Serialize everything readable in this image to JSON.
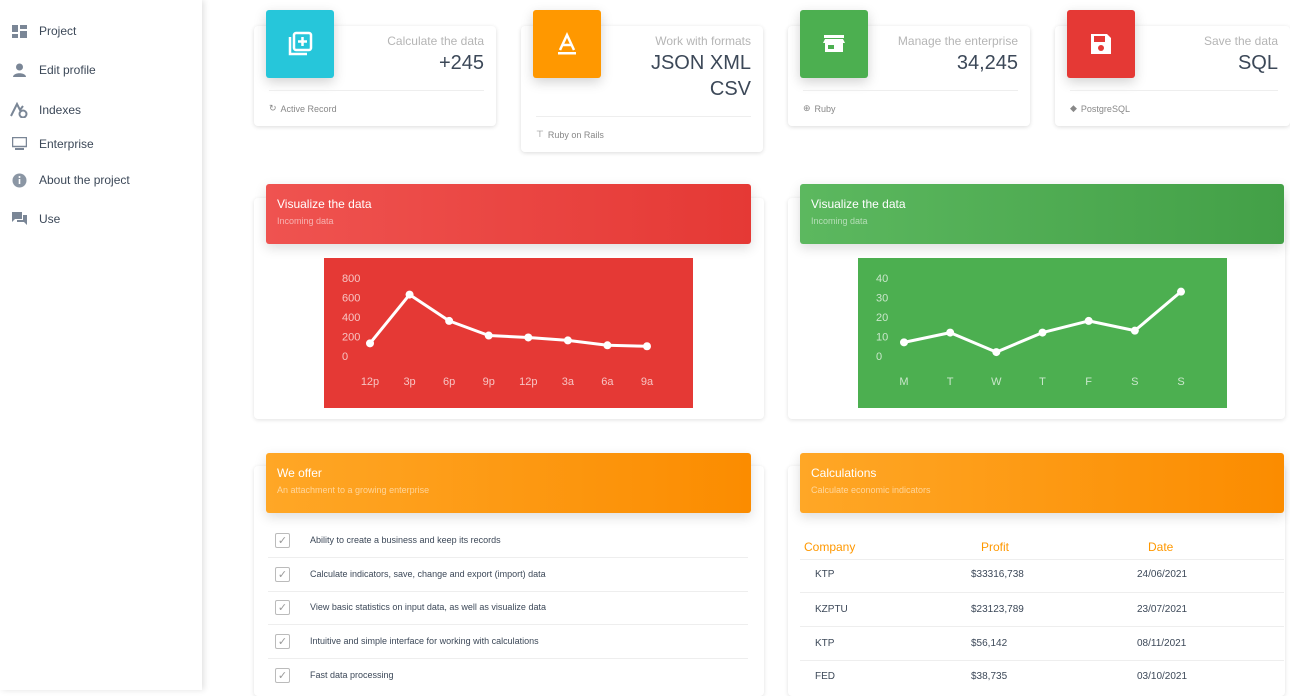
{
  "sidebar": {
    "items": [
      {
        "label": "Project",
        "icon": "dashboard-icon"
      },
      {
        "label": "Edit profile",
        "icon": "person-icon"
      },
      {
        "label": "Indexes",
        "icon": "chart-settings-icon"
      },
      {
        "label": "Enterprise",
        "icon": "monitor-icon"
      },
      {
        "label": "About the project",
        "icon": "info-icon"
      },
      {
        "label": "Use",
        "icon": "forum-icon"
      }
    ]
  },
  "stats": [
    {
      "category": "Calculate the data",
      "value": "+245",
      "footer": "Active Record",
      "color": "#26c6da",
      "icon": "filter-plus-icon",
      "footer_icon": "refresh-icon"
    },
    {
      "category": "Work with formats",
      "value": "JSON XML CSV",
      "footer": "Ruby on Rails",
      "color": "#ff9800",
      "icon": "text-format-icon",
      "footer_icon": "paint-roller-icon"
    },
    {
      "category": "Manage the enterprise",
      "value": "34,245",
      "footer": "Ruby",
      "color": "#4caf50",
      "icon": "store-icon",
      "footer_icon": "globe-icon"
    },
    {
      "category": "Save the data",
      "value": "SQL",
      "footer": "PostgreSQL",
      "color": "#e53935",
      "icon": "floppy-disk-icon",
      "footer_icon": "tag-icon"
    }
  ],
  "charts": {
    "left_title": "Visualize the data",
    "left_subtitle": "Incoming data",
    "right_title": "Visualize the data",
    "right_subtitle": "Incoming data"
  },
  "chart_data": [
    {
      "type": "line",
      "categories": [
        "12p",
        "3p",
        "6p",
        "9p",
        "12p",
        "3a",
        "6a",
        "9a"
      ],
      "values": [
        130,
        630,
        360,
        210,
        190,
        160,
        110,
        100
      ],
      "ylim": [
        0,
        800
      ],
      "yticks": [
        "800",
        "600",
        "400",
        "200",
        "0"
      ],
      "color": "#e53935"
    },
    {
      "type": "line",
      "categories": [
        "M",
        "T",
        "W",
        "T",
        "F",
        "S",
        "S"
      ],
      "values": [
        7,
        12,
        2,
        12,
        18,
        13,
        33
      ],
      "ylim": [
        0,
        40
      ],
      "yticks": [
        "40",
        "30",
        "20",
        "10",
        "0"
      ],
      "color": "#4caf50"
    }
  ],
  "offer": {
    "title": "We offer",
    "subtitle": "An attachment to a growing enterprise",
    "items": [
      "Ability to create a business and keep its records",
      "Calculate indicators, save, change and export (import) data",
      "View basic statistics on input data, as well as visualize data",
      "Intuitive and simple interface for working with calculations",
      "Fast data processing"
    ]
  },
  "calc": {
    "title": "Calculations",
    "subtitle": "Calculate economic indicators",
    "headers": [
      "Company",
      "Profit",
      "Date"
    ],
    "rows": [
      [
        "KTP",
        "$33316,738",
        "24/06/2021"
      ],
      [
        "KZPTU",
        "$23123,789",
        "23/07/2021"
      ],
      [
        "KTP",
        "$56,142",
        "08/11/2021"
      ],
      [
        "FED",
        "$38,735",
        "03/10/2021"
      ]
    ]
  }
}
